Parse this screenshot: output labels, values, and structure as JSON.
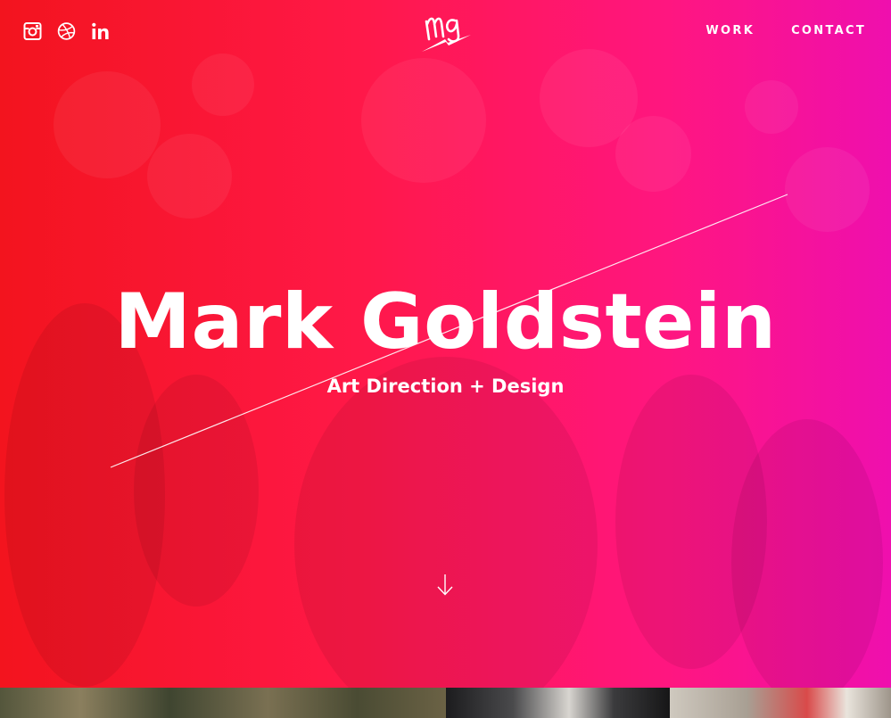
{
  "brand": {
    "logo_text": "mg",
    "gradient_colors": [
      "#f3141e",
      "#ff1848",
      "#ff1680",
      "#ef0fae"
    ]
  },
  "social": [
    {
      "name": "instagram",
      "icon": "instagram-icon"
    },
    {
      "name": "dribbble",
      "icon": "dribbble-icon"
    },
    {
      "name": "linkedin",
      "icon": "linkedin-icon"
    }
  ],
  "nav": {
    "items": [
      {
        "label": "WORK"
      },
      {
        "label": "CONTACT"
      }
    ]
  },
  "hero": {
    "title": "Mark Goldstein",
    "subtitle": "Art Direction + Design",
    "scroll_icon": "arrow-down-icon"
  },
  "portfolio_strip": {
    "thumbnails": [
      {
        "icon": "outdoor-photo-thumbnail"
      },
      {
        "icon": "portrait-photo-thumbnail"
      },
      {
        "icon": "product-photo-thumbnail"
      }
    ]
  }
}
